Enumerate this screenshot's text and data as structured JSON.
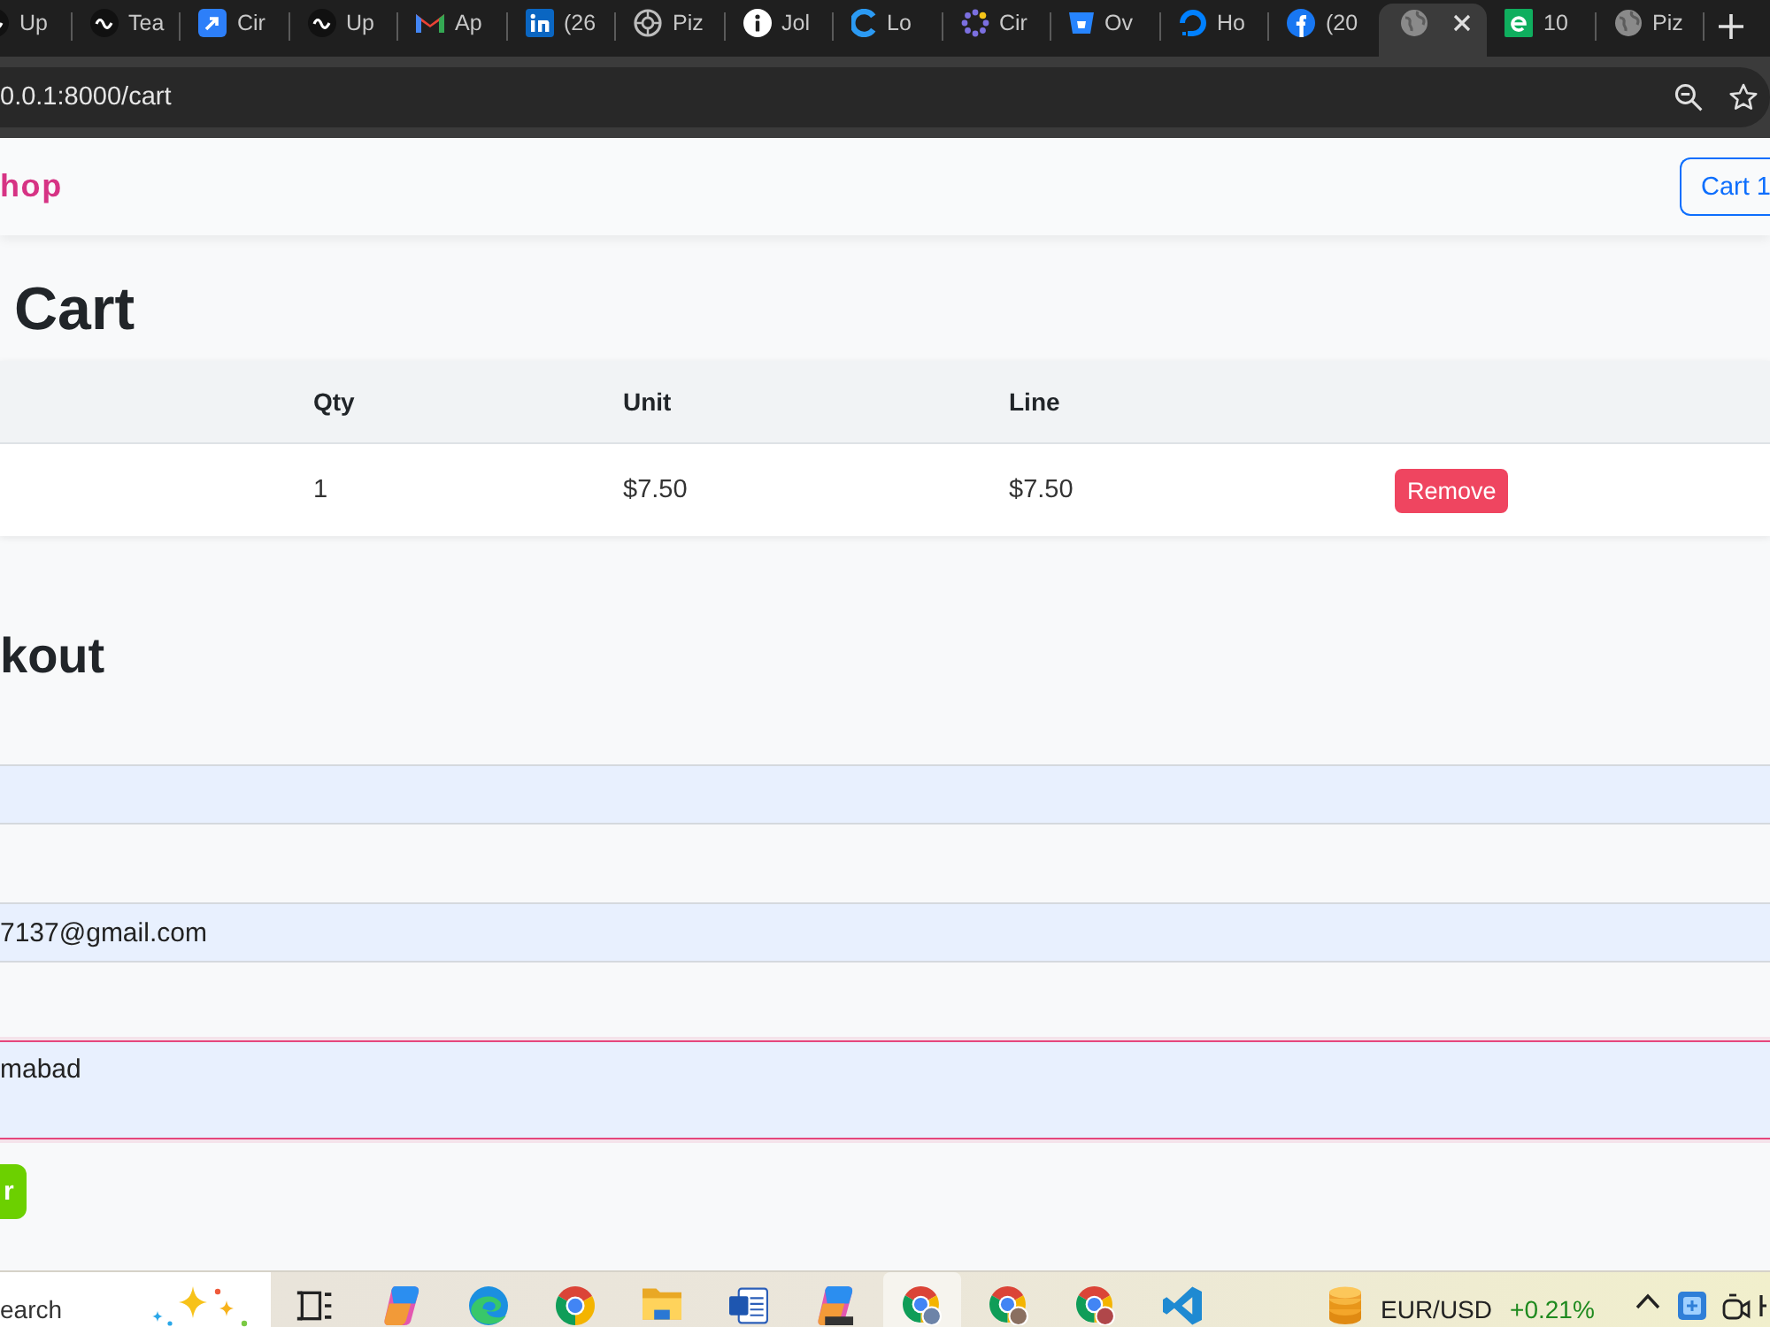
{
  "browser": {
    "tabs": [
      {
        "title": "Up",
        "selected": false
      },
      {
        "title": "Tea",
        "selected": false
      },
      {
        "title": "Cir",
        "selected": false
      },
      {
        "title": "Up",
        "selected": false
      },
      {
        "title": "Ap",
        "selected": false
      },
      {
        "title": "(26",
        "selected": false
      },
      {
        "title": "Piz",
        "selected": false
      },
      {
        "title": "Jol",
        "selected": false
      },
      {
        "title": "Lo",
        "selected": false
      },
      {
        "title": "Cir",
        "selected": false
      },
      {
        "title": "Ov",
        "selected": false
      },
      {
        "title": "Ho",
        "selected": false
      },
      {
        "title": "(20",
        "selected": false
      },
      {
        "selected": true
      },
      {
        "title": "10",
        "selected": false
      },
      {
        "title": "Piz",
        "selected": false
      }
    ],
    "address": "0.0.1:8000/cart"
  },
  "navbar": {
    "brand": "hop",
    "cart_button": "Cart 1"
  },
  "cart": {
    "title": "Cart",
    "columns": [
      "Qty",
      "Unit",
      "Line"
    ],
    "rows": [
      {
        "cells": [
          "1",
          "$7.50",
          "$7.50"
        ],
        "action": "Remove"
      }
    ]
  },
  "checkout": {
    "title": "kout",
    "fields": [
      {
        "kind": "input",
        "focused": false
      },
      {
        "kind": "input",
        "value": "7137@gmail.com",
        "focused": false
      },
      {
        "kind": "textarea",
        "value": "mabad",
        "focused": true
      }
    ],
    "submit": "r"
  },
  "taskbar": {
    "search_placeholder": "earch",
    "apps": [
      {
        "selected": false
      },
      {
        "selected": false
      },
      {
        "selected": false
      },
      {
        "selected": false
      },
      {
        "selected": false
      },
      {
        "selected": false
      },
      {
        "selected": false
      },
      {
        "selected": true
      },
      {
        "selected": false
      },
      {
        "selected": false
      },
      {
        "selected": false
      }
    ],
    "ticker": {
      "symbol": "EUR/USD",
      "change": "+0.21%"
    }
  }
}
